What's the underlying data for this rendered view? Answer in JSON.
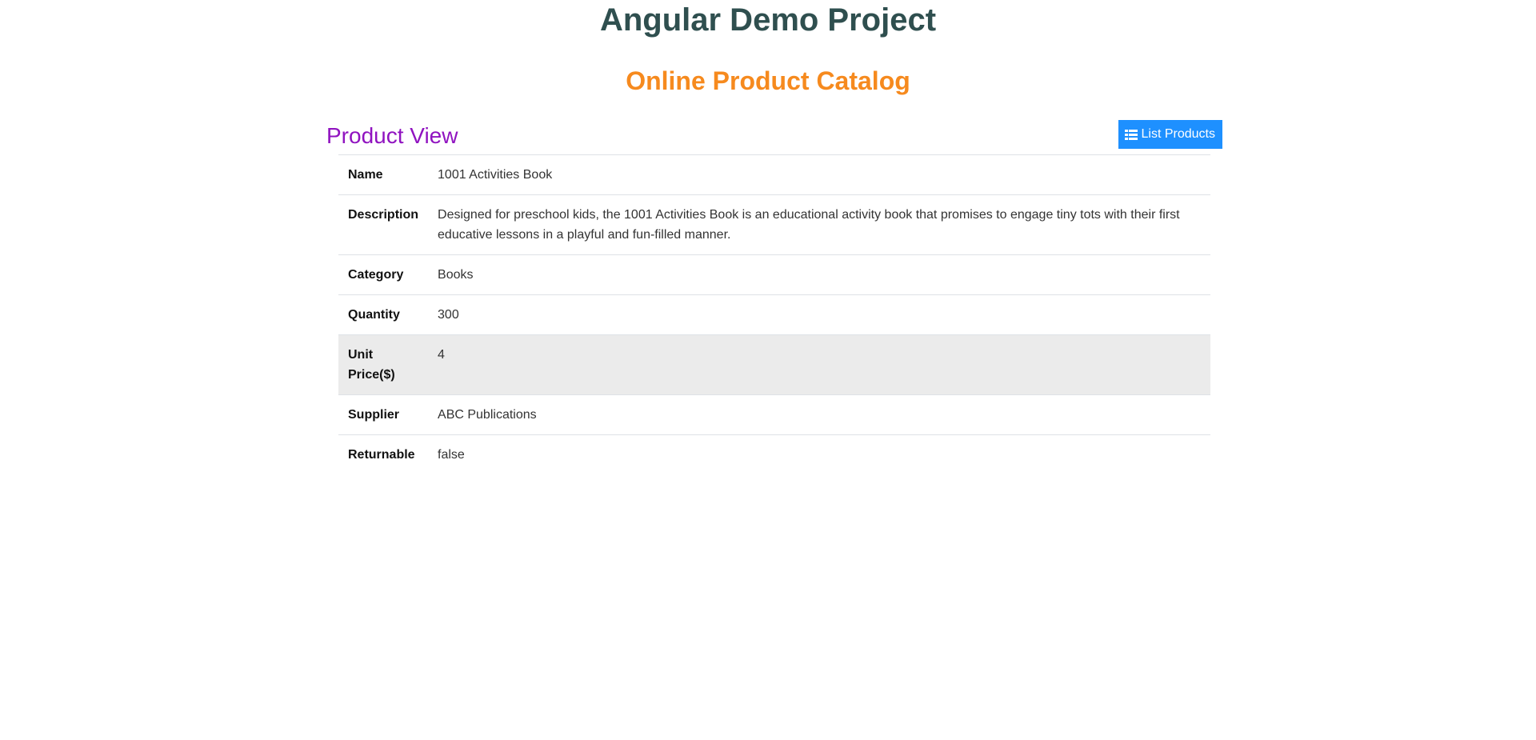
{
  "header": {
    "app_title": "Angular Demo Project",
    "catalog_title": "Online Product Catalog"
  },
  "view": {
    "title": "Product View",
    "list_button_label": "List Products",
    "list_button_icon": "list-icon"
  },
  "product": {
    "rows": [
      {
        "label": "Name",
        "value": "1001 Activities Book"
      },
      {
        "label": "Description",
        "value": "Designed for preschool kids, the 1001 Activities Book is an educational activity book that promises to engage tiny tots with their first educative lessons in a playful and fun-filled manner."
      },
      {
        "label": "Category",
        "value": "Books"
      },
      {
        "label": "Quantity",
        "value": "300"
      },
      {
        "label": "Unit Price($)",
        "value": "4"
      },
      {
        "label": "Supplier",
        "value": "ABC Publications"
      },
      {
        "label": "Returnable",
        "value": "false"
      }
    ]
  },
  "colors": {
    "app_title": "#2f4f4f",
    "catalog_title": "#f68a1e",
    "view_title": "#9013c0",
    "button_bg": "#1e90ff",
    "hover_row_bg": "#ebebeb"
  }
}
